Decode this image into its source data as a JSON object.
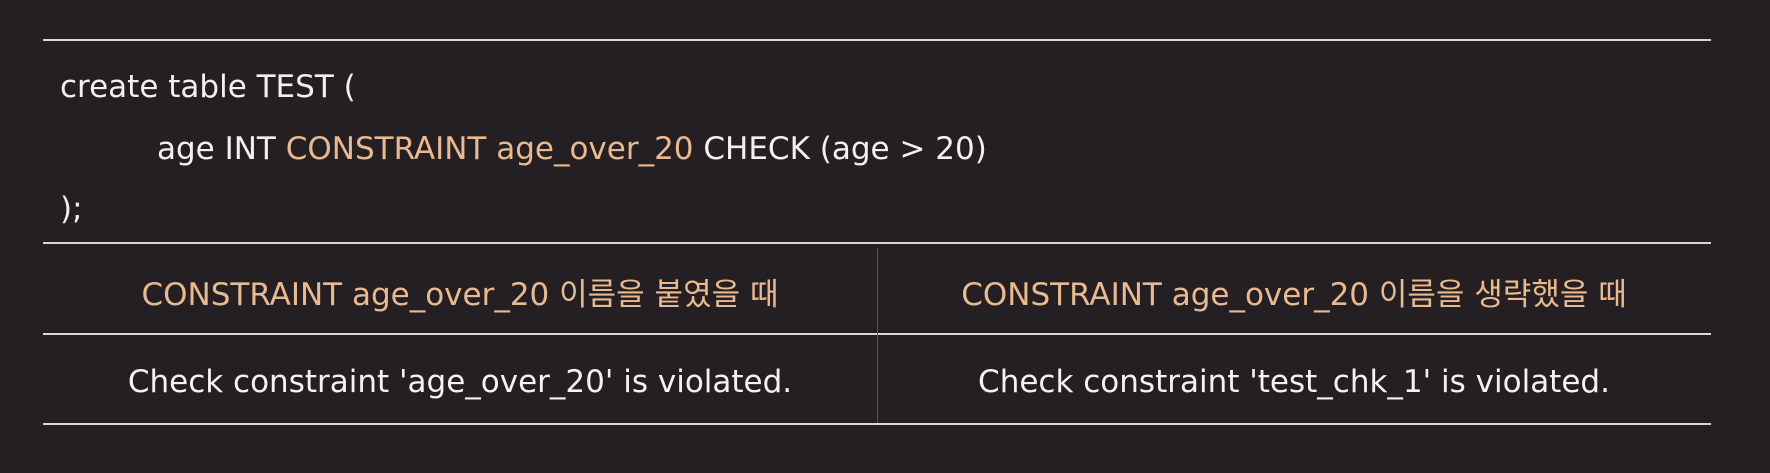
{
  "code": {
    "line1": "create table TEST (",
    "line2_a": "age INT ",
    "line2_kw": "CONSTRAINT age_over_20",
    "line2_b": " CHECK (age > 20)",
    "line3": ");"
  },
  "table": {
    "headers": [
      "CONSTRAINT age_over_20 이름을 붙였을 때",
      "CONSTRAINT age_over_20 이름을 생략했을 때"
    ],
    "row": [
      "Check constraint 'age_over_20' is violated.",
      "Check constraint 'test_chk_1' is violated."
    ]
  },
  "colors": {
    "background": "#231f22",
    "accent": "#eab98d",
    "text": "#f2f0f1",
    "rule": "#d9d6d8"
  }
}
